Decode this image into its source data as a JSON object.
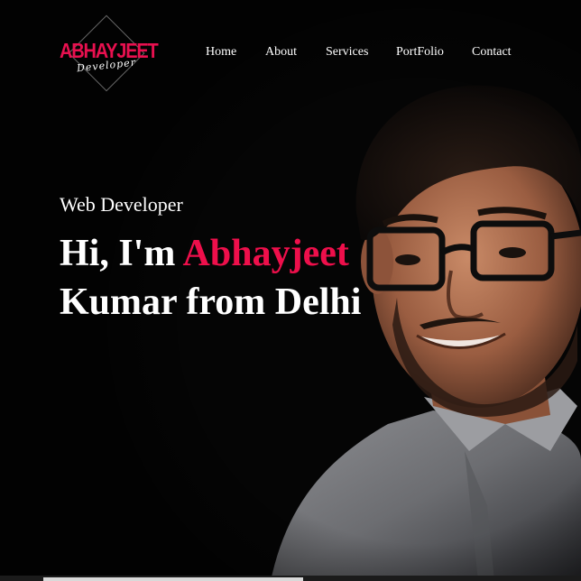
{
  "logo": {
    "title": "ABHAYJEET",
    "subtitle": "Developer"
  },
  "nav": {
    "items": [
      {
        "label": "Home"
      },
      {
        "label": "About"
      },
      {
        "label": "Services"
      },
      {
        "label": "PortFolio"
      },
      {
        "label": "Contact"
      }
    ]
  },
  "hero": {
    "eyebrow": "Web Developer",
    "greeting": "Hi, I'm ",
    "name_highlight": "Abhayjeet",
    "line2": "Kumar from Delhi"
  },
  "colors": {
    "background": "#050505",
    "accent": "#ee0f4b",
    "text": "#ffffff"
  }
}
